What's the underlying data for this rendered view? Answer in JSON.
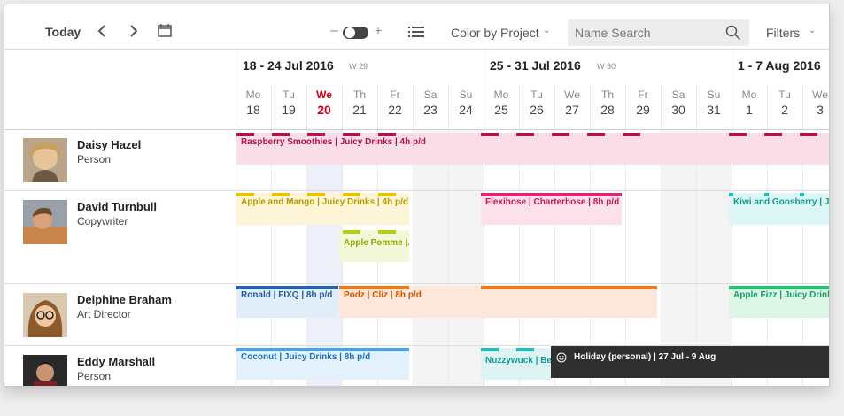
{
  "toolbar": {
    "today_label": "Today",
    "prev_icon": "chevron-left-icon",
    "next_icon": "chevron-right-icon",
    "calendar_icon": "calendar-icon",
    "zoom_minus": "–",
    "zoom_plus": "+",
    "list_icon": "list-icon",
    "color_by_label": "Color by Project",
    "search_placeholder": "Name Search",
    "filters_label": "Filters"
  },
  "weeks": [
    {
      "title": "18 - 24 Jul 2016",
      "num": "W 29"
    },
    {
      "title": "25 - 31 Jul 2016",
      "num": "W 30"
    },
    {
      "title": "1 - 7 Aug 2016",
      "num": ""
    }
  ],
  "days": [
    {
      "name": "Mo",
      "num": "18"
    },
    {
      "name": "Tu",
      "num": "19"
    },
    {
      "name": "We",
      "num": "20"
    },
    {
      "name": "Th",
      "num": "21"
    },
    {
      "name": "Fr",
      "num": "22"
    },
    {
      "name": "Sa",
      "num": "23"
    },
    {
      "name": "Su",
      "num": "24"
    },
    {
      "name": "Mo",
      "num": "25"
    },
    {
      "name": "Tu",
      "num": "26"
    },
    {
      "name": "We",
      "num": "27"
    },
    {
      "name": "Th",
      "num": "28"
    },
    {
      "name": "Fr",
      "num": "29"
    },
    {
      "name": "Sa",
      "num": "30"
    },
    {
      "name": "Su",
      "num": "31"
    },
    {
      "name": "Mo",
      "num": "1"
    },
    {
      "name": "Tu",
      "num": "2"
    },
    {
      "name": "We",
      "num": "3"
    }
  ],
  "people": [
    {
      "name": "Daisy Hazel",
      "role": "Person"
    },
    {
      "name": "David Turnbull",
      "role": "Copywriter"
    },
    {
      "name": "Delphine Braham",
      "role": "Art Director"
    },
    {
      "name": "Eddy Marshall",
      "role": "Person"
    }
  ],
  "tasks": {
    "raspberry": "Raspberry Smoothies | Juicy Drinks | 4h p/d",
    "apple_mango": "Apple and Mango | Juicy Drinks | 4h p/d",
    "apple_pomme": "Apple Pomme |...",
    "flexihose": "Flexihose | Charterhose | 8h p/d",
    "kiwi": "Kiwi and Goosberry | Juicy",
    "ronald": "Ronald | FIXQ | 8h p/d",
    "podz": "Podz | Cliz | 8h p/d",
    "apple_fizz": "Apple Fizz | Juicy Drinks |",
    "coconut": "Coconut | Juicy Drinks | 8h p/d",
    "nuzzywuck": "Nuzzywuck | Be...",
    "holiday": "Holiday (personal) | 27 Jul - 9 Aug"
  },
  "colors": {
    "raspberry_bg": "#f9dde7",
    "raspberry_text": "#b3124f",
    "apple_bg": "#fdf6d6",
    "apple_text": "#b59a00",
    "apple_bar": "#e6c400",
    "pomme_bg": "#f2f8d8",
    "pomme_text": "#8ea800",
    "pomme_bar": "#b8cc1a",
    "flex_bg": "#fde1ea",
    "flex_text": "#c2185b",
    "flex_bar": "#e0266f",
    "kiwi_bg": "#dcf6f5",
    "kiwi_text": "#139a94",
    "kiwi_bar": "#20c0b8",
    "ronald_bg": "#e1eefa",
    "ronald_text": "#1f5c99",
    "ronald_bar": "#1f65b0",
    "podz_bg": "#fde7da",
    "podz_text": "#d35400",
    "podz_bar": "#f07a1a",
    "fizz_bg": "#dcf6e7",
    "fizz_text": "#14a05a",
    "fizz_bar": "#1fc46e",
    "coconut_bg": "#e3f1fc",
    "coconut_text": "#1f6fb5",
    "coconut_bar": "#4aa3e6",
    "nuzzy_bg": "#dcf5f4",
    "nuzzy_text": "#139a94",
    "nuzzy_bar": "#20c0b8",
    "holiday_bg": "#2f2f2f",
    "today_accent": "#d0021b"
  }
}
